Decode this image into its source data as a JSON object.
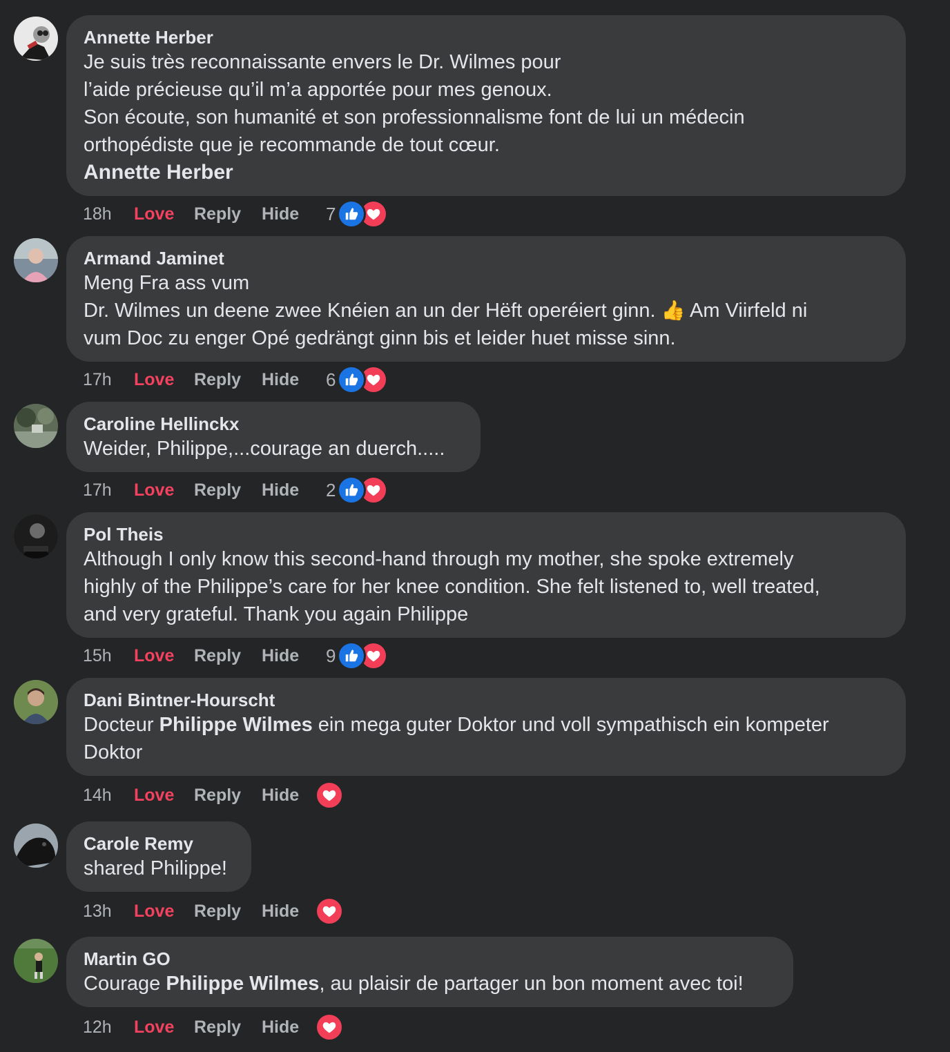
{
  "labels": {
    "love": "Love",
    "reply": "Reply",
    "hide": "Hide"
  },
  "colors": {
    "background": "#242526",
    "bubble": "#3a3b3c",
    "love_accent": "#f3425f",
    "like_blue": "#1b74e4",
    "heart_red": "#f33e58"
  },
  "comments": [
    {
      "author": "Annette Herber",
      "lines": [
        "Je suis très reconnaissante envers le Dr. Wilmes pour",
        "l’aide précieuse qu’il m’a apportée pour mes genoux.",
        "Son écoute, son humanité et son professionnalisme font de lui un médecin",
        "orthopédiste que je recommande de tout cœur."
      ],
      "signature": "Annette Herber",
      "time": "18h",
      "reaction_count": "7",
      "reactions": [
        "like-icon",
        "heart-icon"
      ]
    },
    {
      "author": "Armand Jaminet",
      "lines": [
        "Meng Fra ass vum",
        "Dr. Wilmes un deene zwee Knéien an un der Hëft operéiert ginn.",
        "vum Doc zu enger Opé gedrängt ginn bis et leider huet misse sinn."
      ],
      "emoji": "👍",
      "line2_tail": "Am Viirfeld ni",
      "time": "17h",
      "reaction_count": "6",
      "reactions": [
        "like-icon",
        "heart-icon"
      ]
    },
    {
      "author": "Caroline Hellinckx",
      "lines": [
        "Weider, Philippe,...courage an duerch....."
      ],
      "time": "17h",
      "reaction_count": "2",
      "reactions": [
        "like-icon",
        "heart-icon"
      ]
    },
    {
      "author": "Pol Theis",
      "lines": [
        "Although I only know this second-hand through my mother, she spoke extremely",
        "highly of the Philippe’s care for her knee condition. She felt listened to, well treated,",
        "and very grateful. Thank you again Philippe"
      ],
      "time": "15h",
      "reaction_count": "9",
      "reactions": [
        "like-icon",
        "heart-icon"
      ]
    },
    {
      "author": "Dani Bintner-Hourscht",
      "text_pre": "Docteur ",
      "mention": "Philippe Wilmes",
      "text_post": " ein mega guter Doktor und voll sympathisch ein kompeter",
      "line2": "Doktor",
      "time": "14h",
      "reactions": [
        "heart-icon"
      ]
    },
    {
      "author": "Carole Remy",
      "lines": [
        "shared Philippe!"
      ],
      "time": "13h",
      "reactions": [
        "heart-icon"
      ]
    },
    {
      "author": "Martin GO",
      "text_pre": "Courage ",
      "mention": "Philippe Wilmes",
      "text_post": ", au plaisir de partager un bon moment avec toi!",
      "time": "12h",
      "reactions": [
        "heart-icon"
      ]
    }
  ]
}
